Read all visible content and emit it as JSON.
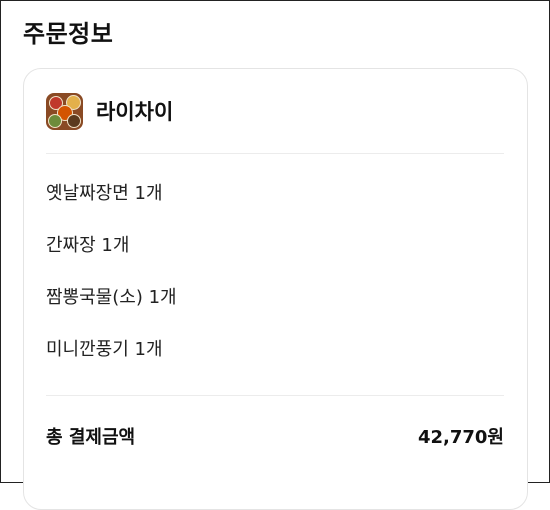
{
  "header": {
    "title": "주문정보"
  },
  "store": {
    "name": "라이차이",
    "logo_icon": "food-dishes-icon"
  },
  "order": {
    "items": [
      {
        "label": "옛날짜장면 1개"
      },
      {
        "label": "간짜장 1개"
      },
      {
        "label": "짬뽕국물(소) 1개"
      },
      {
        "label": "미니깐풍기 1개"
      }
    ]
  },
  "summary": {
    "total_label": "총 결제금액",
    "total_value": "42,770원"
  }
}
